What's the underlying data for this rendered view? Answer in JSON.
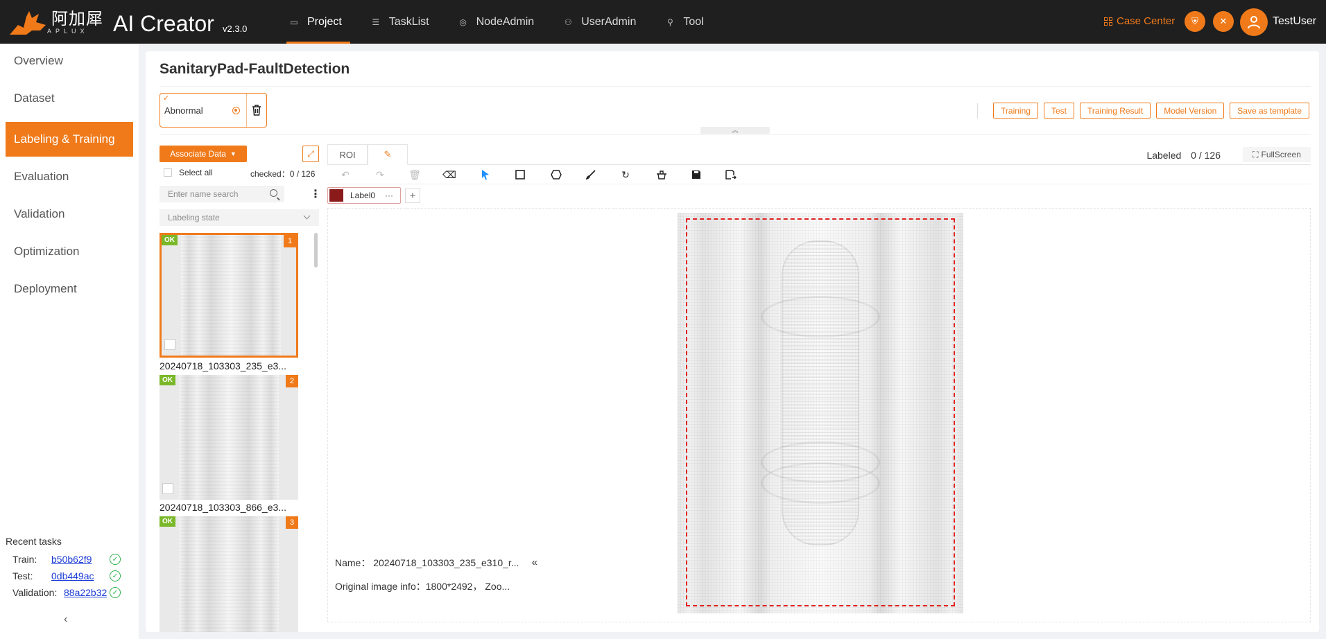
{
  "brand": {
    "cn": "阿加犀",
    "sub": "APLUX",
    "title": "AI Creator",
    "version": "v2.3.0",
    "accent": "#f07a1a"
  },
  "nav": [
    {
      "label": "Project",
      "icon": "folder-icon",
      "active": true
    },
    {
      "label": "TaskList",
      "icon": "list-icon",
      "active": false
    },
    {
      "label": "NodeAdmin",
      "icon": "node-icon",
      "active": false
    },
    {
      "label": "UserAdmin",
      "icon": "users-icon",
      "active": false
    },
    {
      "label": "Tool",
      "icon": "wrench-icon",
      "active": false
    }
  ],
  "header": {
    "case_center": "Case Center",
    "username": "TestUser"
  },
  "sidebar": {
    "items": [
      {
        "label": "Overview"
      },
      {
        "label": "Dataset"
      },
      {
        "label": "Labeling & Training",
        "active": true
      },
      {
        "label": "Evaluation"
      },
      {
        "label": "Validation"
      },
      {
        "label": "Optimization"
      },
      {
        "label": "Deployment"
      }
    ],
    "recent_title": "Recent tasks",
    "recent": [
      {
        "key": "Train:",
        "id": "b50b62f9"
      },
      {
        "key": "Test:",
        "id": "0db449ac"
      },
      {
        "key": "Validation:",
        "id": "88a22b32"
      }
    ],
    "collapse": "‹"
  },
  "page": {
    "title": "SanitaryPad-FaultDetection"
  },
  "category": {
    "label": "Abnormal"
  },
  "actions": [
    "Training",
    "Test",
    "Training Result",
    "Model Version",
    "Save as template"
  ],
  "list": {
    "associate": "Associate Data",
    "select_all": "Select all",
    "checked": "checked：0 / 126",
    "search_placeholder": "Enter name search",
    "state_placeholder": "Labeling state",
    "items": [
      {
        "state": "OK",
        "num": "1",
        "name": "20240718_103303_235_e3..."
      },
      {
        "state": "OK",
        "num": "2",
        "name": "20240718_103303_866_e3..."
      },
      {
        "state": "OK",
        "num": "3",
        "name": ""
      }
    ]
  },
  "editor": {
    "tabs": {
      "roi": "ROI"
    },
    "labeled_label": "Labeled",
    "labeled_count": "0 / 126",
    "fullscreen": "FullScreen",
    "label_name": "Label0",
    "label_color": "#8b1a1a",
    "roi_color": "#e02020",
    "info_name": "Name：  20240718_103303_235_e310_r...",
    "info_orig": "Original image info：1800*2492， Zoo..."
  }
}
